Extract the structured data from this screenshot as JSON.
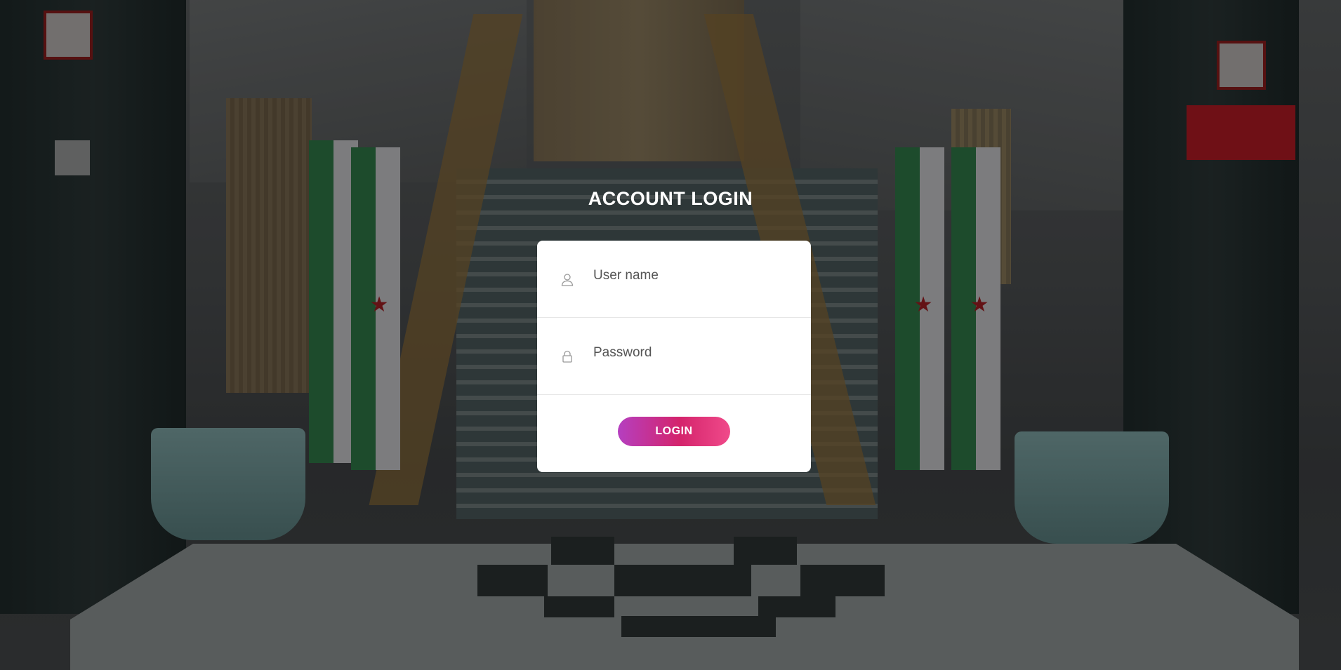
{
  "page": {
    "title": "ACCOUNT LOGIN"
  },
  "form": {
    "username": {
      "placeholder": "User name",
      "value": "",
      "icon": "user-icon"
    },
    "password": {
      "placeholder": "Password",
      "value": "",
      "icon": "lock-icon"
    },
    "submit_label": "LOGIN"
  },
  "colors": {
    "button_gradient_start": "#b53fc0",
    "button_gradient_end": "#f04a8a",
    "card_background": "#ffffff",
    "title_color": "#ffffff"
  }
}
